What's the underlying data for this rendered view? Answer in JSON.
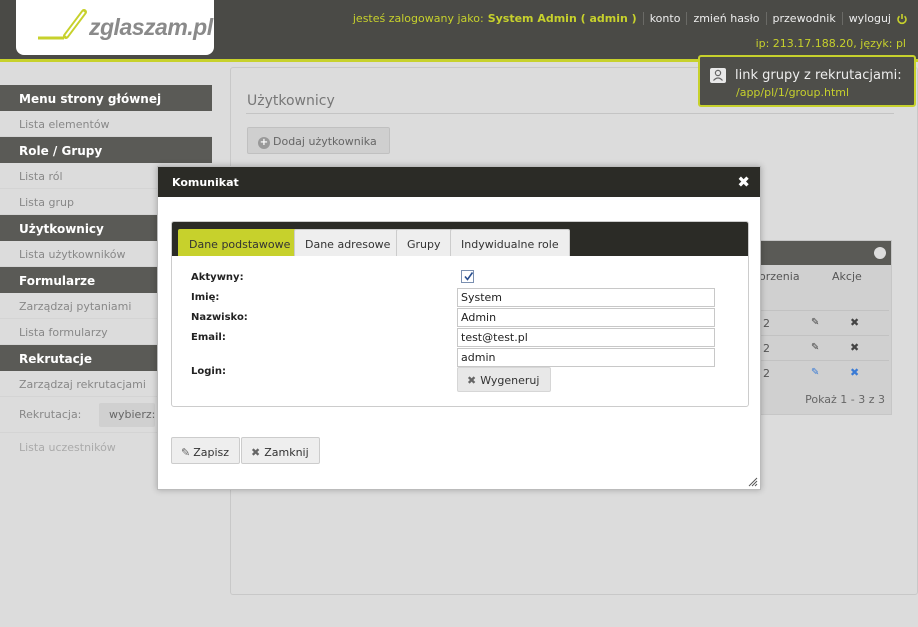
{
  "header": {
    "logo_text": "zglaszam.pl",
    "logged_in_prefix": "jesteś zalogowany jako:",
    "user_name": "System Admin ( admin )",
    "links": [
      "konto",
      "zmień hasło",
      "przewodnik",
      "wyloguj"
    ],
    "ip_info": "ip: 213.17.188.20, język: pl"
  },
  "group_link": {
    "title": "link grupy z rekrutacjami:",
    "url": "/app/pl/1/group.html"
  },
  "sidebar": {
    "sections": [
      {
        "title": "Menu strony głównej",
        "items": [
          "Lista elementów"
        ]
      },
      {
        "title": "Role / Grupy",
        "items": [
          "Lista ról",
          "Lista grup"
        ]
      },
      {
        "title": "Użytkownicy",
        "items": [
          "Lista użytkowników"
        ]
      },
      {
        "title": "Formularze",
        "items": [
          "Zarządzaj pytaniami",
          "Lista formularzy"
        ]
      },
      {
        "title": "Rekrutacje",
        "items": [
          "Zarządzaj rekrutacjami"
        ]
      }
    ],
    "rekrutacja_label": "Rekrutacja:",
    "rekrutacja_select": "wybierz:",
    "participants_link": "Lista uczestników"
  },
  "main": {
    "title": "Użytkownicy",
    "add_button": "Dodaj użytkownika",
    "table": {
      "col_date_partial": "orzenia",
      "col_actions": "Akcje",
      "rows": [
        {
          "date": "2"
        },
        {
          "date": "2"
        },
        {
          "date": "2"
        }
      ],
      "pagination": "Pokaż 1 - 3 z 3"
    }
  },
  "modal": {
    "title": "Komunikat",
    "tabs": [
      "Dane podstawowe",
      "Dane adresowe",
      "Grupy",
      "Indywidualne role"
    ],
    "active_tab": "Dane podstawowe",
    "fields": {
      "active_label": "Aktywny:",
      "active_checked": true,
      "first_name_label": "Imię:",
      "first_name": "System",
      "last_name_label": "Nazwisko:",
      "last_name": "Admin",
      "email_label": "Email:",
      "email": "test@test.pl",
      "login_label": "Login:",
      "login": "admin"
    },
    "generate_button": "Wygeneruj",
    "save_button": "Zapisz",
    "close_button": "Zamknij"
  },
  "colors": {
    "accent": "#c7d12c",
    "dark": "#2b2b26",
    "header_bg": "#4a4a46"
  }
}
